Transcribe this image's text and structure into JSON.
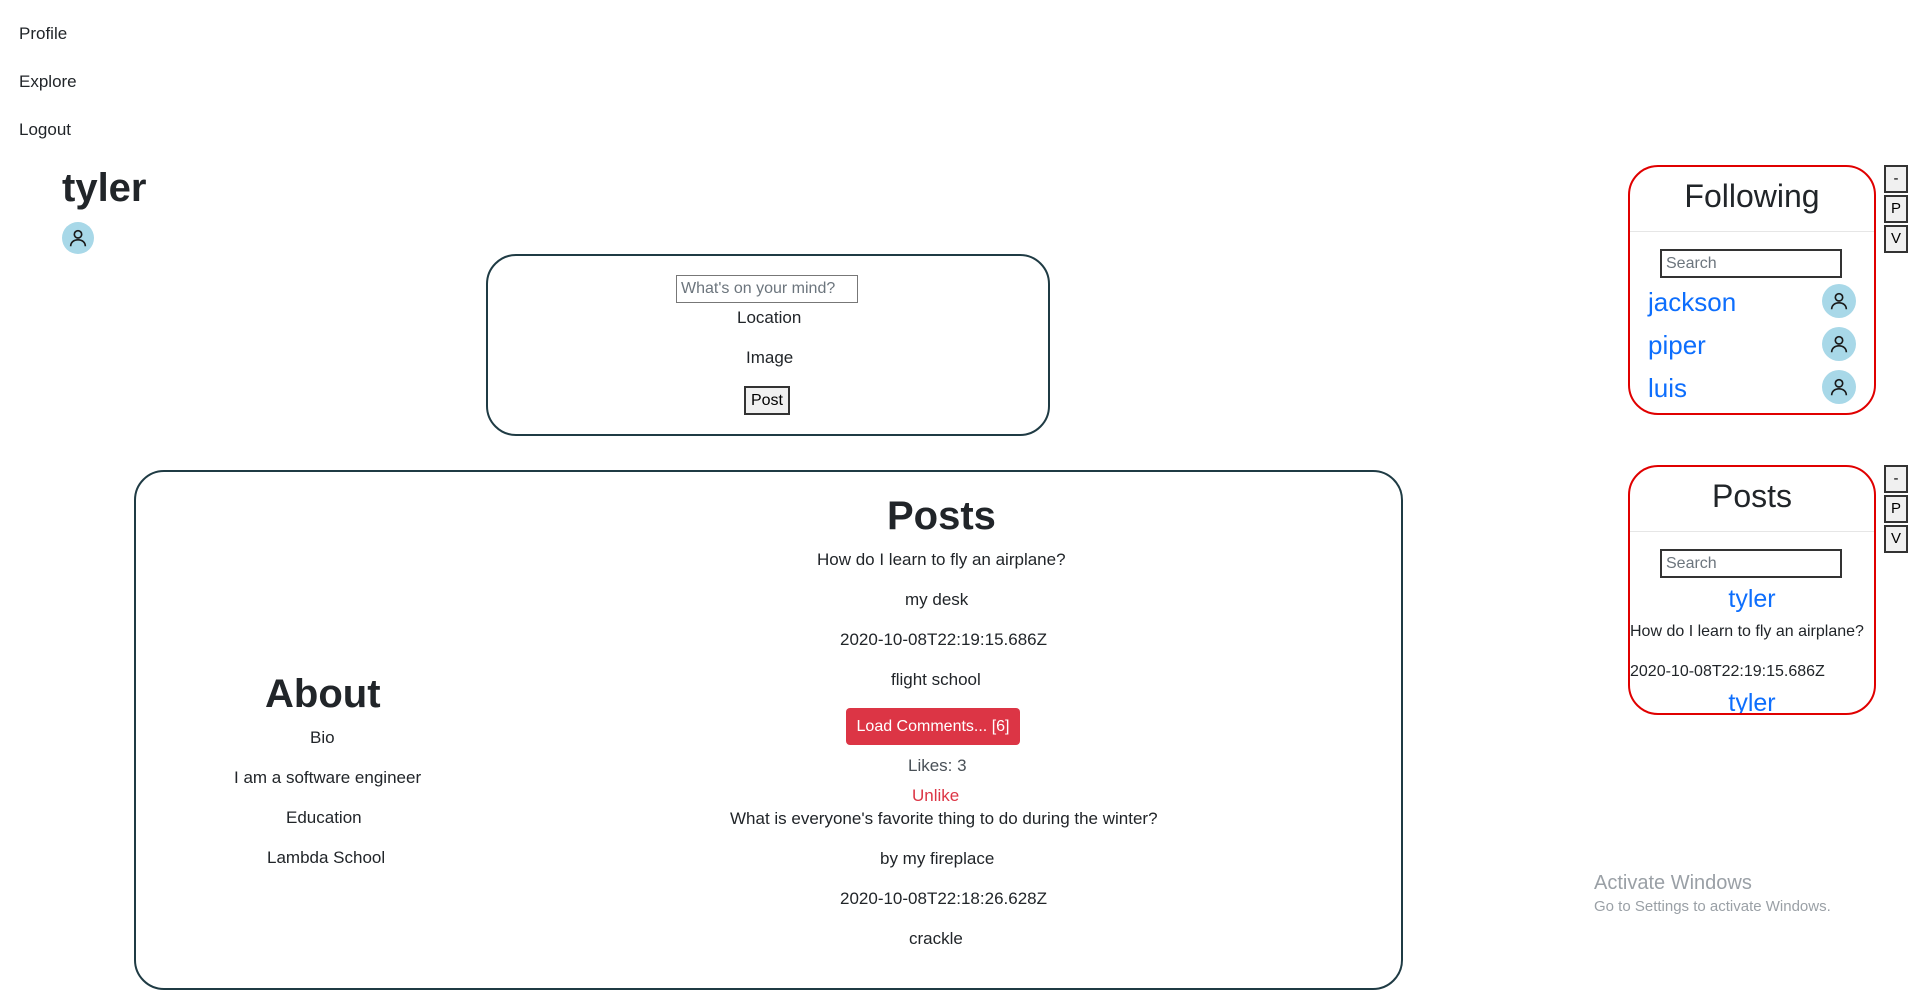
{
  "nav": {
    "profile": "Profile",
    "explore": "Explore",
    "logout": "Logout"
  },
  "profile": {
    "username": "tyler"
  },
  "composer": {
    "placeholder": "What's on your mind?",
    "location_label": "Location",
    "image_label": "Image",
    "post_button": "Post"
  },
  "about": {
    "title": "About",
    "bio_label": "Bio",
    "bio": "I am a software engineer",
    "education_label": "Education",
    "education": "Lambda School"
  },
  "posts": {
    "title": "Posts",
    "items": [
      {
        "text": "How do I learn to fly an airplane?",
        "location": "my desk",
        "timestamp": "2020-10-08T22:19:15.686Z",
        "image": "flight school",
        "load_comments": "Load Comments... [6]",
        "likes": "Likes: 3",
        "unlike": "Unlike"
      },
      {
        "text": "What is everyone's favorite thing to do during the winter?",
        "location": "by my fireplace",
        "timestamp": "2020-10-08T22:18:26.628Z",
        "image": "crackle"
      }
    ]
  },
  "following": {
    "title": "Following",
    "search_placeholder": "Search",
    "users": [
      "jackson",
      "piper",
      "luis"
    ]
  },
  "feed": {
    "title": "Posts",
    "search_placeholder": "Search",
    "items": [
      {
        "author": "tyler",
        "text": "How do I learn to fly an airplane?",
        "timestamp": "2020-10-08T22:19:15.686Z"
      },
      {
        "author": "tyler"
      }
    ]
  },
  "widget_controls": {
    "minimize": "-",
    "p": "P",
    "v": "V"
  },
  "watermark": {
    "line1": "Activate Windows",
    "line2": "Go to Settings to activate Windows."
  },
  "colors": {
    "accent_red": "#dc3545",
    "link_blue": "#0d6efd",
    "avatar_bg": "#a8d8e8",
    "box_border": "#1f3b44",
    "widget_border": "#e00000"
  }
}
